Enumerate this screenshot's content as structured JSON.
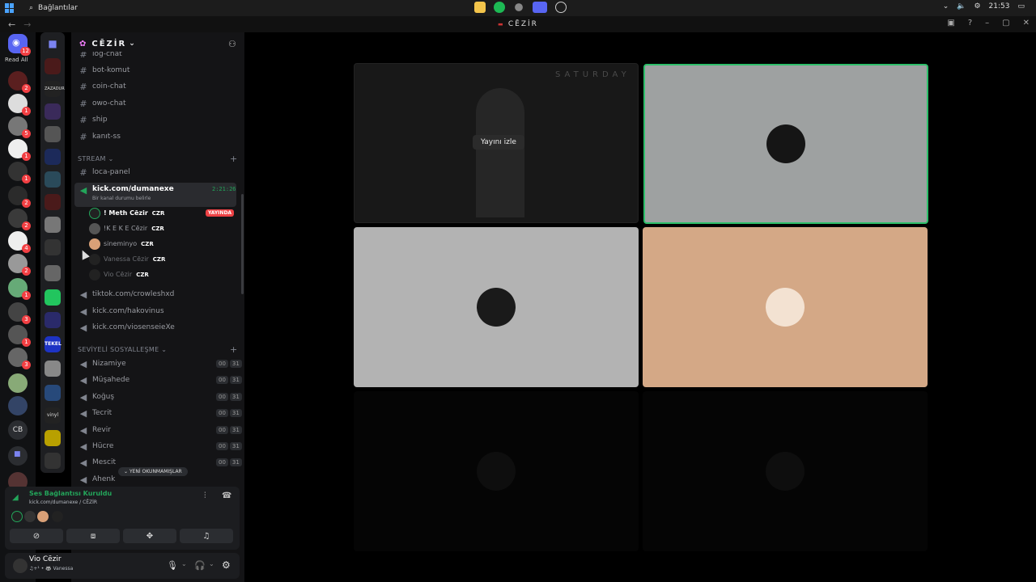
{
  "taskbar": {
    "search_label": "Bağlantılar",
    "time": "21:53"
  },
  "app": {
    "title": "CĒZİR"
  },
  "rail": {
    "read_all": "Read All",
    "dm_badge": "12",
    "cb_label": "CB",
    "vinyl": "vinyl",
    "tekel": "TEKEL",
    "zazadur": "ZAZADUR"
  },
  "server": {
    "name": "CĒZİR"
  },
  "channels": {
    "top": [
      "log-chat",
      "bot-komut",
      "coin-chat",
      "owo-chat",
      "ship",
      "kanıt-ss"
    ],
    "stream_category": "STREAM",
    "stream_text": "loca-panel",
    "active": {
      "name": "kick.com/dumanexe",
      "status": "Bir kanal durumu belirle",
      "timer": "2:21:26"
    },
    "users": [
      {
        "name": "! Meth Cēzir",
        "tag": "CZR",
        "live": "YAYINDA"
      },
      {
        "name": "!K E K E Cēzir",
        "tag": "CZR"
      },
      {
        "name": "sineminyo",
        "tag": "CZR"
      },
      {
        "name": "Vanessa Cēzir",
        "tag": "CZR"
      },
      {
        "name": "Vio Cēzir",
        "tag": "CZR"
      }
    ],
    "voice_more": [
      "tiktok.com/crowleshxd",
      "kick.com/hakovinus",
      "kick.com/viosenseieXe"
    ],
    "social_category": "SEVİYELİ SOSYALLEŞME",
    "social": [
      {
        "name": "Nizamiye",
        "a": "00",
        "b": "31"
      },
      {
        "name": "Müşahede",
        "a": "00",
        "b": "31"
      },
      {
        "name": "Koğuş",
        "a": "00",
        "b": "31"
      },
      {
        "name": "Tecrit",
        "a": "00",
        "b": "31"
      },
      {
        "name": "Revir",
        "a": "00",
        "b": "31"
      },
      {
        "name": "Hücre",
        "a": "00",
        "b": "31"
      },
      {
        "name": "Mescit",
        "a": "00",
        "b": "31"
      },
      {
        "name": "Ahenk",
        "a": "",
        "b": ""
      }
    ],
    "unread_pill": "YENİ OKUNMAMIŞLAR"
  },
  "voice": {
    "status": "Ses Bağlantısı Kuruldu",
    "sub": "kick.com/dumanexe / CĒZİR"
  },
  "me": {
    "name": "Vio Cēzir",
    "activity": "♫+¹ • 🦝 Vanessa"
  },
  "stage": {
    "watch_label": "Yayını izle",
    "stream_banner": "SATURDAY"
  },
  "colors": {
    "accent": "#5865f2",
    "online": "#23a55a",
    "live": "#ed4245"
  }
}
